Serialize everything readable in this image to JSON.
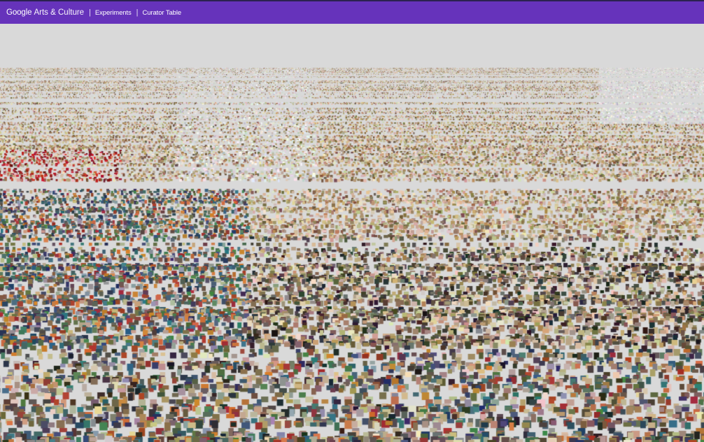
{
  "header": {
    "brand_google": "Google",
    "brand_rest": "Arts & Culture",
    "separator": "|",
    "breadcrumbs": [
      {
        "label": "Experiments"
      },
      {
        "label": "Curator Table"
      }
    ]
  },
  "colors": {
    "header_bg": "#6633bb",
    "header_border": "#2b2250",
    "canvas_bg": "#d9d9d9"
  },
  "scene": {
    "type": "3d-image-tile-landscape",
    "description_items": "thousands of artwork thumbnail tiles arranged on a perspective plane"
  }
}
